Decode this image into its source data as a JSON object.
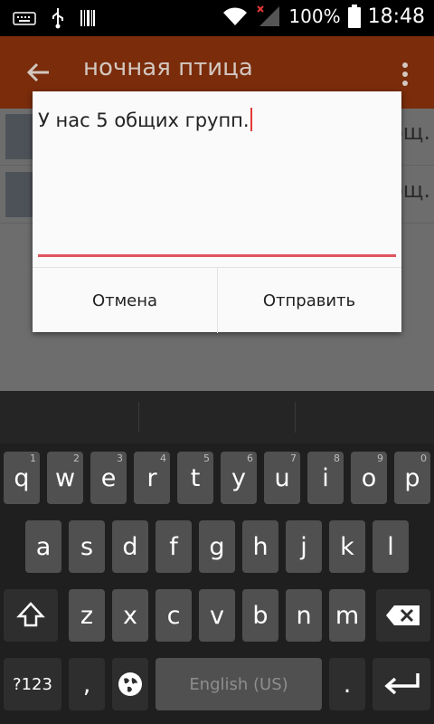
{
  "status_bar": {
    "battery_percent": "100%",
    "time": "18:48",
    "icons": [
      "keyboard-icon",
      "usb-icon",
      "barcode-icon",
      "wifi-icon",
      "signal-no-data-icon",
      "battery-icon"
    ]
  },
  "app_bar": {
    "title": "ночная птица"
  },
  "list_behind": {
    "rows": [
      {
        "snippet": "общ."
      },
      {
        "snippet": "общ."
      }
    ]
  },
  "dialog": {
    "message_value": "У нас 5 общих групп.",
    "cancel_label": "Отмена",
    "send_label": "Отправить"
  },
  "keyboard": {
    "row1": [
      {
        "label": "q",
        "hint": "1"
      },
      {
        "label": "w",
        "hint": "2"
      },
      {
        "label": "e",
        "hint": "3"
      },
      {
        "label": "r",
        "hint": "4"
      },
      {
        "label": "t",
        "hint": "5"
      },
      {
        "label": "y",
        "hint": "6"
      },
      {
        "label": "u",
        "hint": "7"
      },
      {
        "label": "i",
        "hint": "8"
      },
      {
        "label": "o",
        "hint": "9"
      },
      {
        "label": "p",
        "hint": "0"
      }
    ],
    "row2": [
      "a",
      "s",
      "d",
      "f",
      "g",
      "h",
      "j",
      "k",
      "l"
    ],
    "row3": [
      "z",
      "x",
      "c",
      "v",
      "b",
      "n",
      "m"
    ],
    "symbols_label": "?123",
    "comma_label": ",",
    "space_label": "English (US)",
    "period_label": "."
  },
  "colors": {
    "accent": "#e0545c",
    "appbar_dimmed": "#7a2c0b",
    "key": "#505050"
  }
}
